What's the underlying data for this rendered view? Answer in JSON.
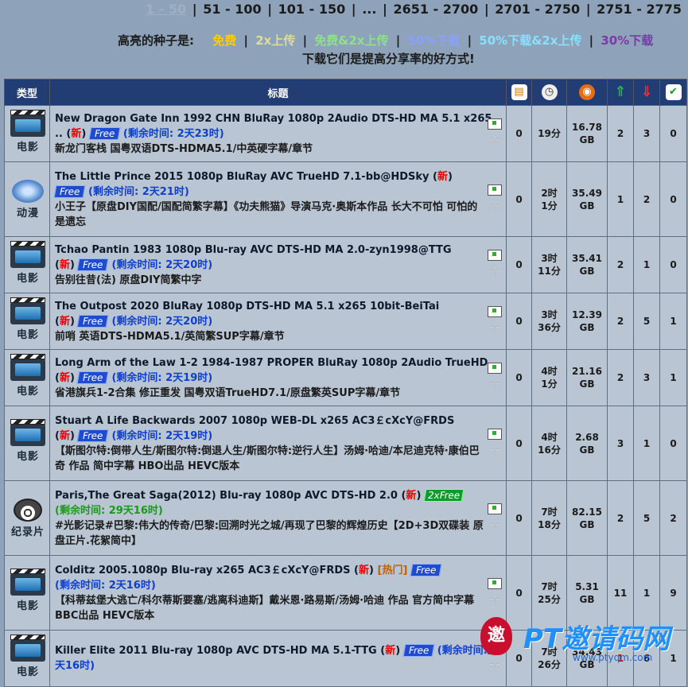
{
  "pager": {
    "current": "1 - 50",
    "pages": [
      "51 - 100",
      "101 - 150",
      "...",
      "2651 - 2700",
      "2701 - 2750",
      "2751 - 2775"
    ]
  },
  "legend": {
    "label": "高亮的种子是:",
    "items": [
      {
        "text": "免费",
        "color": "#ffcc00"
      },
      {
        "text": "2x上传",
        "color": "#dddd99"
      },
      {
        "text": "免费&2x上传",
        "color": "#8ee08e"
      },
      {
        "text": "50%下载",
        "color": "#8aa0ff"
      },
      {
        "text": "50%下载&2x上传",
        "color": "#88e0ff"
      },
      {
        "text": "30%下载",
        "color": "#7a3aa8"
      }
    ],
    "tip": "下载它们是提高分享率的好方式!"
  },
  "headers": {
    "type": "类型",
    "title": "标题"
  },
  "rows": [
    {
      "type_icon": "movie-icon",
      "type_label": "电影",
      "name": "New Dragon Gate Inn 1992 CHN BluRay 1080p 2Audio DTS-HD MA 5.1 x265 ..",
      "new": "新",
      "badge": "Free",
      "remaining_prefix": "剩余时间: ",
      "remaining": "2天23时",
      "subtitle": "新龙门客栈 国粤双语DTS-HDMA5.1/中英硬字幕/章节",
      "comments": "0",
      "age_line1": "19分",
      "age_line2": "",
      "size_line1": "16.78",
      "size_line2": "GB",
      "seeders": "2",
      "leechers": "3",
      "completed": "0"
    },
    {
      "type_icon": "anime-icon",
      "type_label": "动漫",
      "name": "The Little Prince 2015 1080p BluRay AVC TrueHD 7.1-bb@HDSky",
      "new": "新",
      "badge": "Free",
      "remaining_prefix": "剩余时间: ",
      "remaining": "2天21时",
      "subtitle": "小王子【原盘DIY国配/国配简繁字幕】《功夫熊猫》导演马克·奥斯本作品 长大不可怕 可怕的是遗忘",
      "comments": "0",
      "age_line1": "2时",
      "age_line2": "1分",
      "size_line1": "35.49",
      "size_line2": "GB",
      "seeders": "1",
      "leechers": "2",
      "completed": "0"
    },
    {
      "type_icon": "movie-icon",
      "type_label": "电影",
      "name": "Tchao Pantin 1983 1080p Blu-ray AVC DTS-HD MA 2.0-zyn1998@TTG",
      "new": "新",
      "badge": "Free",
      "remaining_prefix": "剩余时间: ",
      "remaining": "2天20时",
      "subtitle": "告别往昔(法) 原盘DIY简繁中字",
      "comments": "0",
      "age_line1": "3时",
      "age_line2": "11分",
      "size_line1": "35.41",
      "size_line2": "GB",
      "seeders": "2",
      "leechers": "1",
      "completed": "0"
    },
    {
      "type_icon": "movie-icon",
      "type_label": "电影",
      "name": "The Outpost 2020 BluRay 1080p DTS-HD MA 5.1 x265 10bit-BeiTai",
      "new": "新",
      "badge": "Free",
      "remaining_prefix": "剩余时间: ",
      "remaining": "2天20时",
      "subtitle": "前哨 英语DTS-HDMA5.1/英简繁SUP字幕/章节",
      "comments": "0",
      "age_line1": "3时",
      "age_line2": "36分",
      "size_line1": "12.39",
      "size_line2": "GB",
      "seeders": "2",
      "leechers": "5",
      "completed": "1"
    },
    {
      "type_icon": "movie-icon",
      "type_label": "电影",
      "name": "Long Arm of the Law 1-2 1984-1987 PROPER BluRay 1080p 2Audio TrueHD ..",
      "new": "新",
      "badge": "Free",
      "remaining_prefix": "剩余时间: ",
      "remaining": "2天19时",
      "subtitle": "省港旗兵1-2合集 修正重发 国粤双语TrueHD7.1/原盘繁英SUP字幕/章节",
      "comments": "0",
      "age_line1": "4时",
      "age_line2": "1分",
      "size_line1": "21.16",
      "size_line2": "GB",
      "seeders": "2",
      "leechers": "3",
      "completed": "1"
    },
    {
      "type_icon": "movie-icon",
      "type_label": "电影",
      "name": "Stuart A Life Backwards 2007 1080p WEB-DL x265 AC3￡cXcY@FRDS",
      "new": "新",
      "badge": "Free",
      "remaining_prefix": "剩余时间: ",
      "remaining": "2天19时",
      "subtitle": "【斯图尔特:倒带人生/斯图尔特:倒退人生/斯图尔特:逆行人生】汤姆·哈迪/本尼迪克特·康伯巴奇 作品 简中字幕 HBO出品 HEVC版本",
      "comments": "0",
      "age_line1": "4时",
      "age_line2": "16分",
      "size_line1": "2.68",
      "size_line2": "GB",
      "seeders": "3",
      "leechers": "1",
      "completed": "0"
    },
    {
      "type_icon": "documentary-icon",
      "type_label": "纪录片",
      "name": "Paris,The Great Saga(2012) Blu-ray 1080p AVC DTS-HD 2.0",
      "new": "新",
      "badge": "2xFree",
      "remaining_prefix": "剩余时间: ",
      "remaining": "29天16时",
      "subtitle": "#光影记录#巴黎:伟大的传奇/巴黎:回溯时光之城/再现了巴黎的辉煌历史【2D+3D双碟装 原盘正片.花絮简中】",
      "comments": "0",
      "age_line1": "7时",
      "age_line2": "18分",
      "size_line1": "82.15",
      "size_line2": "GB",
      "seeders": "2",
      "leechers": "5",
      "completed": "2"
    },
    {
      "type_icon": "movie-icon",
      "type_label": "电影",
      "name": "Colditz 2005.1080p Blu-ray x265 AC3￡cXcY@FRDS",
      "new": "新",
      "hot": "热门",
      "badge": "Free",
      "remaining_prefix": "剩余时间: ",
      "remaining": "2天16时",
      "subtitle": "【科蒂兹堡大逃亡/科尔蒂斯要塞/逃离科迪斯】戴米恩·路易斯/汤姆·哈迪 作品 官方简中字幕 BBC出品 HEVC版本",
      "comments": "0",
      "age_line1": "7时",
      "age_line2": "25分",
      "size_line1": "5.31",
      "size_line2": "GB",
      "seeders": "11",
      "leechers": "1",
      "completed": "9"
    },
    {
      "type_icon": "movie-icon",
      "type_label": "电影",
      "name": "Killer Elite 2011 Blu-ray 1080p AVC DTS-HD MA 5.1-TTG",
      "new": "新",
      "badge": "Free",
      "remaining_prefix": "剩余时间: ",
      "remaining": "2天16时",
      "subtitle": "",
      "comments": "0",
      "age_line1": "7时",
      "age_line2": "26分",
      "size_line1": "34.43",
      "size_line2": "GB",
      "seeders": "1",
      "leechers": "6",
      "completed": "1"
    }
  ],
  "watermark": {
    "logo": "邀",
    "text": "PT邀请码网",
    "url": "www.ptyqm.com"
  }
}
